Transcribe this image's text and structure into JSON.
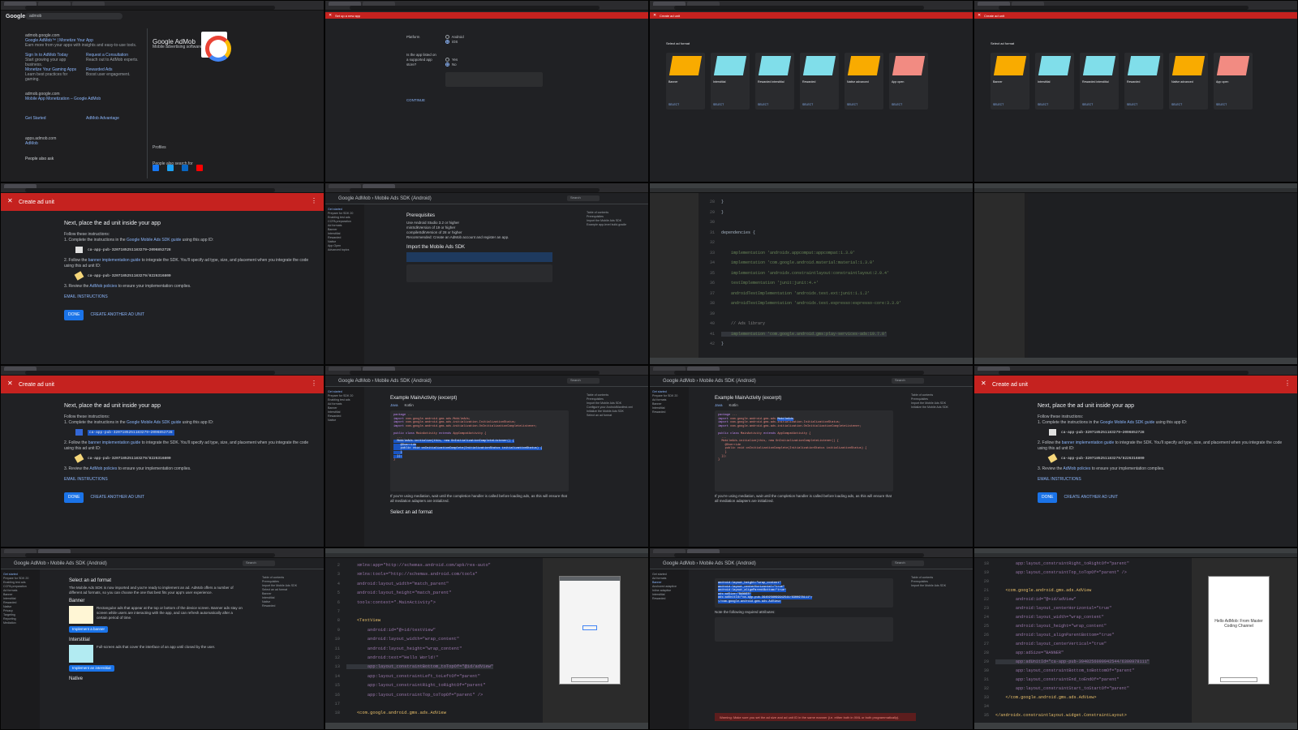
{
  "search": {
    "query": "admob",
    "results": [
      {
        "url": "admob.google.com",
        "title": "Google AdMob™ | Monetize Your App",
        "snippet": "Earn more from your apps with insights and easy-to-use tools."
      },
      {
        "url": "",
        "title": "Sign In to AdMob Today",
        "snippet": "Start growing your app business."
      },
      {
        "url": "",
        "title": "Request a Consultation",
        "snippet": "Reach out to AdMob experts."
      },
      {
        "url": "",
        "title": "Monetize Your Gaming Apps",
        "snippet": "Learn best practices for gaming."
      },
      {
        "url": "",
        "title": "Rewarded Ads",
        "snippet": "Boost user engagement."
      },
      {
        "url": "admob.google.com",
        "title": "Mobile App Monetization – Google AdMob",
        "snippet": ""
      },
      {
        "url": "",
        "title": "Get Started",
        "snippet": ""
      },
      {
        "url": "",
        "title": "AdMob Advantage",
        "snippet": ""
      },
      {
        "url": "apps.admob.com",
        "title": "AdMob",
        "snippet": ""
      }
    ],
    "people_also_ask": "People also ask",
    "knowledge_panel": {
      "title": "Google AdMob",
      "subtitle": "Mobile advertising software",
      "profiles": "Profiles",
      "people_also_search": "People also search for"
    }
  },
  "setup_app": {
    "header": "Set up a new app",
    "platform_label": "Platform",
    "options": [
      "Android",
      "iOS"
    ],
    "store_question": "Is the app listed on a supported app store?",
    "yes": "Yes",
    "no": "No",
    "continue": "CONTINUE"
  },
  "create_ad_unit": {
    "header": "Create ad unit",
    "select_format": "Select ad format",
    "formats": [
      {
        "name": "Banner",
        "color": "#f9ab00"
      },
      {
        "name": "Interstitial",
        "color": "#80deea"
      },
      {
        "name": "Rewarded interstitial",
        "color": "#80deea"
      },
      {
        "name": "Rewarded",
        "color": "#80deea"
      },
      {
        "name": "Native advanced",
        "color": "#f9ab00"
      },
      {
        "name": "App open",
        "color": "#f28b82"
      }
    ],
    "select": "SELECT",
    "heading": "Next, place the ad unit inside your app",
    "follow": "Follow these instructions:",
    "step1_pre": "1. Complete the instructions in the",
    "step1_link": "Google Mobile Ads SDK guide",
    "step1_post": "using this app ID:",
    "app_id": "ca-app-pub-3207185251183279~2096852728",
    "step2_pre": "2. Follow the",
    "step2_link": "banner implementation guide",
    "step2_post": "to integrate the SDK. You'll specify ad type, size, and placement when you integrate the code using this ad unit ID:",
    "ad_unit_id": "ca-app-pub-3207185251183279/8226316800",
    "step3_pre": "3. Review the",
    "step3_link": "AdMob policies",
    "step3_post": "to ensure your implementation complies.",
    "email": "EMAIL INSTRUCTIONS",
    "done": "DONE",
    "create_another": "CREATE ANOTHER AD UNIT",
    "footer": "© 2022 Google · Privacy · Terms"
  },
  "docs": {
    "brand": "Google AdMob",
    "product": "Mobile Ads SDK (Android)",
    "search_placeholder": "Search",
    "lang": "English",
    "prereq_title": "Prerequisites",
    "prereqs": [
      "Use Android Studio 3.2 or higher",
      "minSdkVersion of 19 or higher",
      "compileSdkVersion of 28 or higher",
      "Recommended: Create an AdMob account and register an app."
    ],
    "import_title": "Import the Mobile Ads SDK",
    "example_label": "Example MainActivity (excerpt)",
    "lang_tabs": [
      "Java",
      "Kotlin"
    ],
    "mediation_note": "If you're using mediation, wait until the completion handler is called before loading ads, as this will ensure that all mediation adapters are initialized.",
    "select_format_title": "Select an ad format",
    "select_format_body": "The Mobile Ads SDK is now imported and you're ready to implement an ad. AdMob offers a number of different ad formats, so you can choose the one that best fits your app's user experience.",
    "banner_title": "Banner",
    "banner_body": "Rectangular ads that appear at the top or bottom of the device screen. Banner ads stay on screen while users are interacting with the app, and can refresh automatically after a certain period of time.",
    "impl_banner": "Implement a banner",
    "interstitial_title": "Interstitial",
    "interstitial_body": "Full-screen ads that cover the interface of an app until closed by the user.",
    "impl_interstitial": "Implement an interstitial",
    "native_title": "Native",
    "sidebar": [
      "Get started",
      "Prepare for SDK 20",
      "Enabling test ads",
      "CCPA preparation",
      "Ad formats",
      "Banner",
      "Anchored adaptive",
      "Inline adaptive",
      "Interstitial",
      "Rewarded",
      "Native",
      "App Open",
      "Advanced topics",
      "Privacy",
      "Targeting",
      "Reporting",
      "Mediation"
    ],
    "toc": [
      "Table of contents",
      "Prerequisites",
      "Import the Mobile Ads SDK",
      "Example app-level build.gradle",
      "Configure your AndroidManifest.xml",
      "Initialize the Mobile Ads SDK",
      "Select an ad format",
      "Banner",
      "Interstitial",
      "Native",
      "Rewarded"
    ],
    "attributes_note": "Note the following required attributes:",
    "warning": "Warning: Make sure you set the ad size and ad unit ID in the same manner (i.e. either both in XML or both programmatically)."
  },
  "ide": {
    "gradle": [
      {
        "n": "28",
        "t": "}"
      },
      {
        "n": "29",
        "t": "}"
      },
      {
        "n": "30",
        "t": ""
      },
      {
        "n": "31",
        "t": "dependencies {"
      },
      {
        "n": "32",
        "t": ""
      },
      {
        "n": "33",
        "t": "    implementation 'androidx.appcompat:appcompat:1.3.0'"
      },
      {
        "n": "34",
        "t": "    implementation 'com.google.android.material:material:1.3.0'"
      },
      {
        "n": "35",
        "t": "    implementation 'androidx.constraintlayout:constraintlayout:2.0.4'"
      },
      {
        "n": "36",
        "t": "    testImplementation 'junit:junit:4.+'"
      },
      {
        "n": "37",
        "t": "    androidTestImplementation 'androidx.test.ext:junit:1.1.2'"
      },
      {
        "n": "38",
        "t": "    androidTestImplementation 'androidx.test.espresso:espresso-core:3.3.0'"
      },
      {
        "n": "39",
        "t": ""
      },
      {
        "n": "40",
        "t": "    // Ads library"
      },
      {
        "n": "41",
        "t": "    implementation 'com.google.android.gms:play-services-ads:19.7.0'"
      },
      {
        "n": "42",
        "t": "}"
      }
    ],
    "xml": [
      {
        "n": "2",
        "t": "    xmlns:app=\"http://schemas.android.com/apk/res-auto\""
      },
      {
        "n": "3",
        "t": "    xmlns:tools=\"http://schemas.android.com/tools\""
      },
      {
        "n": "4",
        "t": "    android:layout_width=\"match_parent\""
      },
      {
        "n": "5",
        "t": "    android:layout_height=\"match_parent\""
      },
      {
        "n": "6",
        "t": "    tools:context=\".MainActivity\">"
      },
      {
        "n": "7",
        "t": ""
      },
      {
        "n": "8",
        "t": "    <TextView"
      },
      {
        "n": "9",
        "t": "        android:id=\"@+id/textView\""
      },
      {
        "n": "10",
        "t": "        android:layout_width=\"wrap_content\""
      },
      {
        "n": "11",
        "t": "        android:layout_height=\"wrap_content\""
      },
      {
        "n": "12",
        "t": "        android:text=\"Hello World!\""
      },
      {
        "n": "13",
        "t": "        app:layout_constraintBottom_toTopOf=\"@id/adView\""
      },
      {
        "n": "14",
        "t": "        app:layout_constraintLeft_toLeftOf=\"parent\""
      },
      {
        "n": "15",
        "t": "        app:layout_constraintRight_toRightOf=\"parent\""
      },
      {
        "n": "16",
        "t": "        app:layout_constraintTop_toTopOf=\"parent\" />"
      },
      {
        "n": "17",
        "t": ""
      },
      {
        "n": "18",
        "t": "    <com.google.android.gms.ads.AdView"
      }
    ],
    "xml2": [
      {
        "n": "18",
        "t": "        app:layout_constraintRight_toRightOf=\"parent\""
      },
      {
        "n": "19",
        "t": "        app:layout_constraintTop_toTopOf=\"parent\" />"
      },
      {
        "n": "20",
        "t": ""
      },
      {
        "n": "21",
        "t": "    <com.google.android.gms.ads.AdView"
      },
      {
        "n": "22",
        "t": "        android:id=\"@+id/adView\""
      },
      {
        "n": "23",
        "t": "        android:layout_centerHorizontal=\"true\""
      },
      {
        "n": "24",
        "t": "        android:layout_width=\"wrap_content\""
      },
      {
        "n": "25",
        "t": "        android:layout_height=\"wrap_content\""
      },
      {
        "n": "26",
        "t": "        android:layout_alignParentBottom=\"true\""
      },
      {
        "n": "27",
        "t": "        android:layout_centerVertical=\"true\""
      },
      {
        "n": "28",
        "t": "        app:adSize=\"BANNER\""
      },
      {
        "n": "29",
        "t": "        app:adUnitId=\"ca-app-pub-3940256099942544/6300978111\""
      },
      {
        "n": "30",
        "t": "        app:layout_constraintBottom_toBottomOf=\"parent\""
      },
      {
        "n": "31",
        "t": "        app:layout_constraintEnd_toEndOf=\"parent\""
      },
      {
        "n": "32",
        "t": "        app:layout_constraintStart_toStartOf=\"parent\""
      },
      {
        "n": "33",
        "t": "    </com.google.android.gms.ads.AdView>"
      },
      {
        "n": "34",
        "t": ""
      },
      {
        "n": "35",
        "t": "</androidx.constraintlayout.widget.ConstraintLayout>"
      }
    ],
    "preview_text": "Hello AdMob: From Master Coding Channel"
  },
  "colors": {
    "admob_red": "#c5221f",
    "link": "#8ab4f8",
    "primary_button": "#1a73e8"
  }
}
